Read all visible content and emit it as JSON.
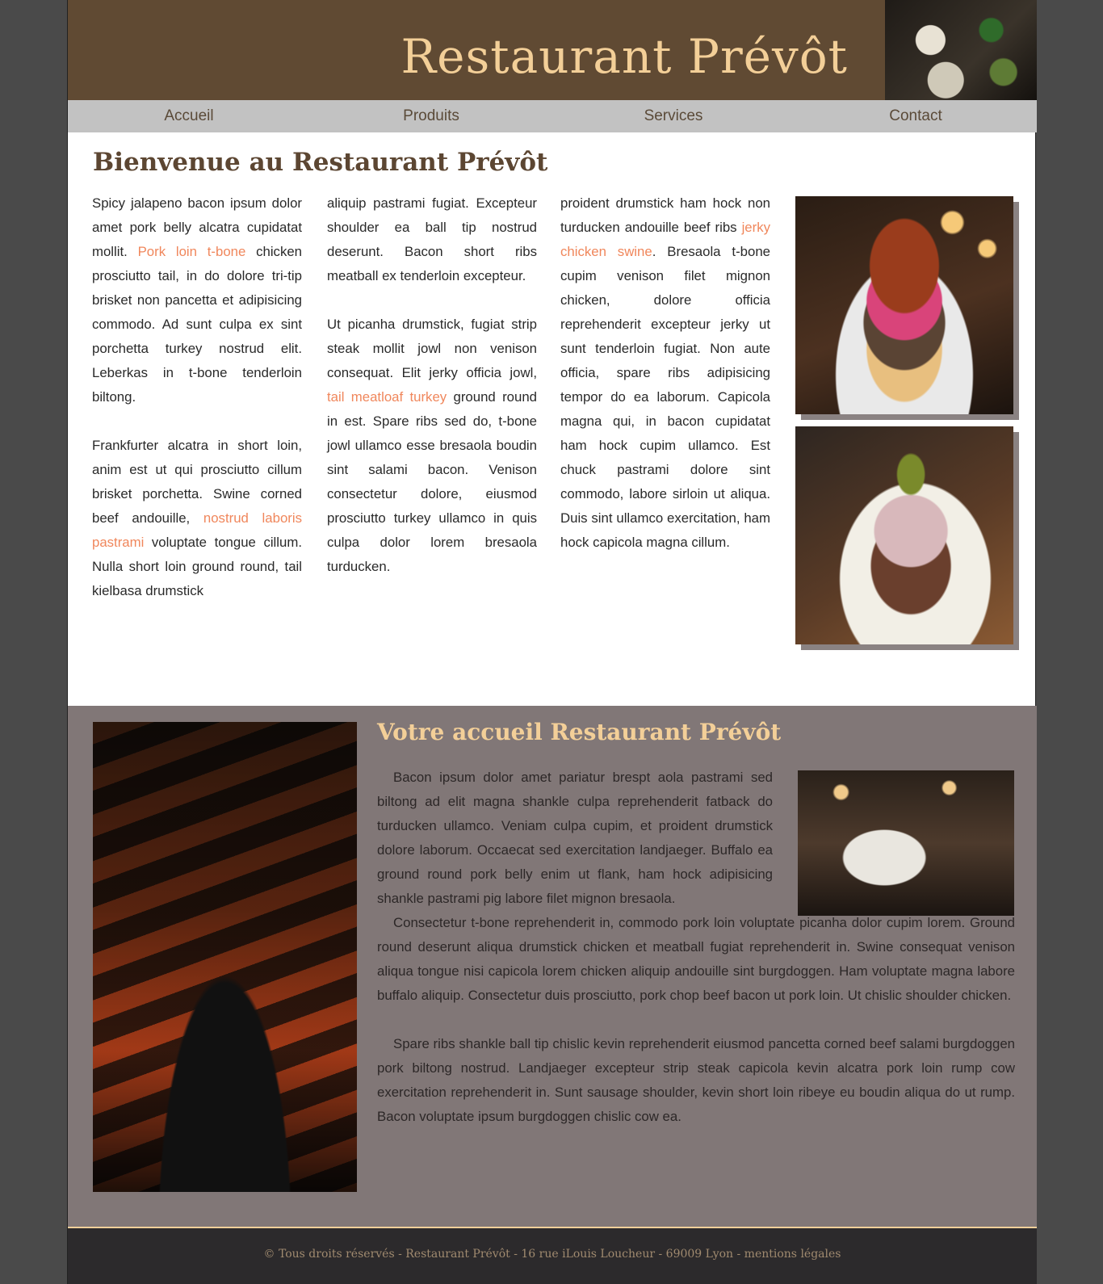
{
  "header": {
    "title": "Restaurant Prévôt"
  },
  "nav": {
    "items": [
      "Accueil",
      "Produits",
      "Services",
      "Contact"
    ]
  },
  "welcome": {
    "title": "Bienvenue au Restaurant Prévôt",
    "col1": {
      "p1_a": "Spicy jalapeno bacon ipsum dolor amet pork belly alcatra cupidatat mollit. ",
      "p1_link": "Pork loin t-bone",
      "p1_b": " chicken prosciutto tail, in do dolore tri-tip brisket non pancetta et adipisicing commodo. Ad sunt culpa ex sint porchetta turkey nostrud elit. Leberkas in t-bone tenderloin biltong.",
      "p2_a": "Frankfurter alcatra in short loin, anim est ut qui prosciutto cillum brisket porchetta. Swine corned beef andouille, ",
      "p2_link": "nostrud laboris pastrami",
      "p2_b": " voluptate tongue cillum. Nulla short loin ground round, tail kielbasa drumstick"
    },
    "col2": {
      "p1": "aliquip pastrami fugiat. Excepteur shoulder ea ball tip nostrud deserunt. Bacon short ribs meatball ex tenderloin excepteur.",
      "p2_a": "Ut picanha drumstick, fugiat strip steak mollit jowl non venison consequat. Elit jerky officia jowl, ",
      "p2_link": "tail meatloaf turkey",
      "p2_b": " ground round in est. Spare ribs sed do, t-bone jowl ullamco esse bresaola boudin sint salami bacon. Venison consectetur dolore, eiusmod prosciutto turkey ullamco in quis culpa dolor lorem bresaola turducken."
    },
    "col3": {
      "p1_a": "proident drumstick ham hock non turducken andouille beef ribs ",
      "p1_link": "jerky chicken swine",
      "p1_b": ". Bresaola t-bone cupim venison filet mignon chicken, dolore officia reprehenderit excepteur jerky ut sunt tenderloin fugiat. Non aute officia, spare ribs adipisicing tempor do ea laborum. Capicola magna qui, in bacon cupidatat ham hock cupim ullamco. Est chuck pastrami dolore sint commodo, labore sirloin ut aliqua. Duis sint ullamco exercitation, ham hock capicola magna cillum."
    }
  },
  "accueil": {
    "title": "Votre accueil Restaurant Prévôt",
    "p1": "Bacon ipsum dolor amet pariatur brespt aola pastrami sed biltong ad elit magna shankle culpa reprehenderit fatback do turducken ullamco. Veniam culpa cupim, et proident drumstick dolore laborum. Occaecat sed exercitation landjaeger. Buffalo ea ground round pork belly enim ut flank, ham hock adipisicing shankle pastrami pig labore filet mignon bresaola.",
    "p2": "Consectetur t-bone reprehenderit in, commodo pork loin voluptate picanha dolor cupim lorem. Ground round deserunt aliqua drumstick chicken et meatball fugiat reprehenderit in. Swine consequat venison aliqua tongue nisi capicola lorem chicken aliquip andouille sint burgdoggen. Ham voluptate magna labore buffalo aliquip. Consectetur duis prosciutto, pork chop beef bacon ut pork loin. Ut chislic shoulder chicken.",
    "p3": "Spare ribs shankle ball tip chislic kevin reprehenderit eiusmod pancetta corned beef salami burgdoggen pork biltong nostrud. Landjaeger excepteur strip steak capicola kevin alcatra pork loin rump cow exercitation reprehenderit in. Sunt sausage shoulder, kevin short loin ribeye eu boudin aliqua do ut rump. Bacon voluptate ipsum burgdoggen chislic cow ea."
  },
  "footer": {
    "text": "© Tous droits réservés - Restaurant Prévôt - 16 rue iLouis Loucheur - 69009 Lyon - mentions légales"
  },
  "colors": {
    "header_bg": "#604a33",
    "title_gold": "#f3cf98",
    "nav_bg": "#c2c2c2",
    "link_accent": "#f0875c",
    "section2_bg": "#817777",
    "footer_bg": "#2c2a2c"
  }
}
